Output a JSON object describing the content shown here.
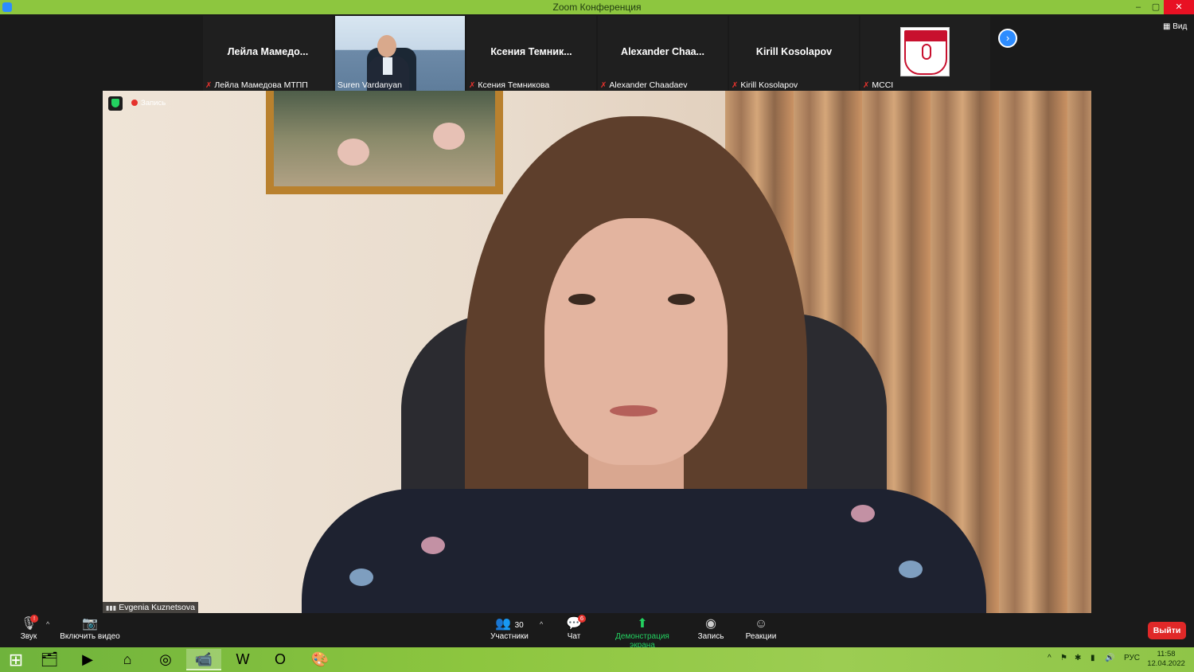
{
  "window": {
    "title": "Zoom Конференция",
    "minimize": "–",
    "maximize": "▢",
    "close": "✕"
  },
  "gallery": {
    "view_label": "Вид",
    "next_icon": "›",
    "tiles": [
      {
        "big_name": "Лейла  Мамедо...",
        "caption": "Лейла Мамедова МТПП",
        "muted": true
      },
      {
        "big_name": "",
        "caption": "Suren Vardanyan",
        "muted": false,
        "video": true
      },
      {
        "big_name": "Ксения  Темник...",
        "caption": "Ксения Темникова",
        "muted": true
      },
      {
        "big_name": "Alexander  Chaa...",
        "caption": "Alexander Chaadaev",
        "muted": true
      },
      {
        "big_name": "Kirill  Kosolapov",
        "caption": "Kirill Kosolapov",
        "muted": true
      },
      {
        "big_name": "",
        "caption": "MCCI",
        "muted": true,
        "logo": true
      }
    ]
  },
  "main": {
    "recording_label": "Запись",
    "speaker_name": "Evgenia Kuznetsova"
  },
  "toolbar": {
    "audio_label": "Звук",
    "video_label": "Включить видео",
    "participants_label": "Участники",
    "participants_count": "30",
    "chat_label": "Чат",
    "chat_badge": "6",
    "share_label": "Демонстрация экрана",
    "record_label": "Запись",
    "reactions_label": "Реакции",
    "leave_label": "Выйти",
    "audio_badge": "!"
  },
  "taskbar": {
    "language": "РУС",
    "time": "11:58",
    "date": "12.04.2022"
  },
  "colors": {
    "titlebar": "#8dc63f",
    "accent": "#2d8cff",
    "share_green": "#23d160",
    "leave_red": "#e02828"
  }
}
